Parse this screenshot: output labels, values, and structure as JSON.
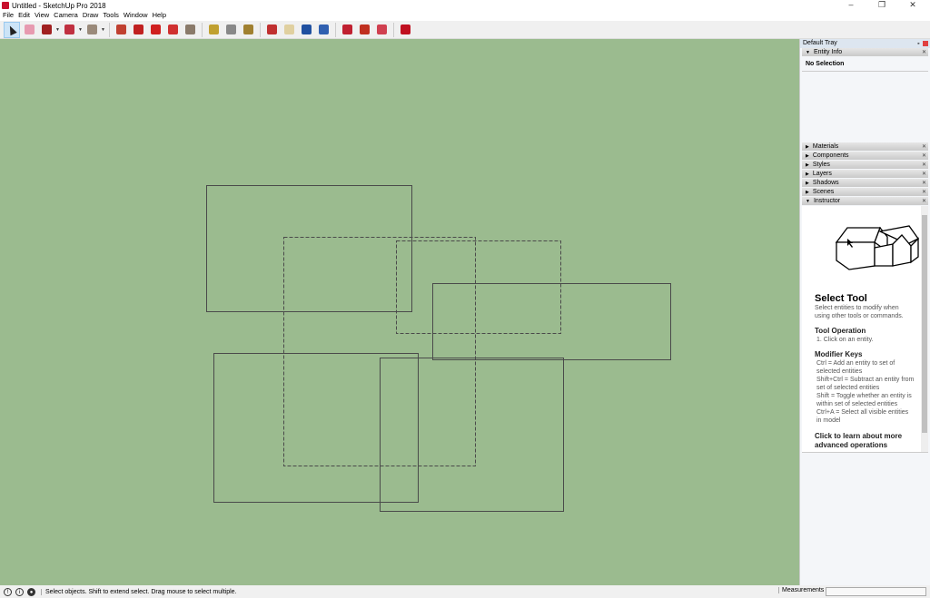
{
  "window": {
    "title": "Untitled - SketchUp Pro 2018",
    "controls": [
      "–",
      "❐",
      "✕"
    ]
  },
  "menu": [
    "File",
    "Edit",
    "View",
    "Camera",
    "Draw",
    "Tools",
    "Window",
    "Help"
  ],
  "toolbar": [
    {
      "icon": "select-icon",
      "color": "#222",
      "active": true
    },
    {
      "icon": "eraser-icon",
      "color": "#e79ab0"
    },
    {
      "icon": "pencil-icon",
      "color": "#a02020",
      "dropdown": true
    },
    {
      "icon": "arc-icon",
      "color": "#c03040",
      "dropdown": true
    },
    {
      "icon": "rectangle-icon",
      "color": "#9a8a7a",
      "dropdown": true
    },
    {
      "sep": true
    },
    {
      "icon": "push-pull-icon",
      "color": "#c04030"
    },
    {
      "icon": "offset-icon",
      "color": "#c02020"
    },
    {
      "icon": "move-icon",
      "color": "#d02020"
    },
    {
      "icon": "rotate-icon",
      "color": "#d03030"
    },
    {
      "icon": "scale-icon",
      "color": "#8a7a6a"
    },
    {
      "sep": true
    },
    {
      "icon": "tape-measure-icon",
      "color": "#c0a030"
    },
    {
      "icon": "text-icon",
      "color": "#888"
    },
    {
      "icon": "paint-bucket-icon",
      "color": "#a08030"
    },
    {
      "sep": true
    },
    {
      "icon": "orbit-icon",
      "color": "#c03030"
    },
    {
      "icon": "pan-icon",
      "color": "#e0d0a0"
    },
    {
      "icon": "zoom-icon",
      "color": "#2050a0"
    },
    {
      "icon": "zoom-extents-icon",
      "color": "#3060b0"
    },
    {
      "sep": true
    },
    {
      "icon": "3d-warehouse-icon",
      "color": "#c02030"
    },
    {
      "icon": "extension-warehouse-icon",
      "color": "#c03020"
    },
    {
      "icon": "send-to-layout-icon",
      "color": "#d04050"
    },
    {
      "sep": true
    },
    {
      "icon": "extension-manager-icon",
      "color": "#c01020"
    }
  ],
  "tray": {
    "title": "Default Tray",
    "entity_info": {
      "label": "Entity Info",
      "body": "No Selection"
    },
    "panels": [
      "Materials",
      "Components",
      "Styles",
      "Layers",
      "Shadows",
      "Scenes"
    ],
    "instructor": {
      "label": "Instructor",
      "title": "Select Tool",
      "desc": "Select entities to modify when using other tools or commands.",
      "op_title": "Tool Operation",
      "op_text": "1. Click on an entity.",
      "mod_title": "Modifier Keys",
      "mod_lines": [
        "Ctrl = Add an entity to set of selected entities",
        "Shift+Ctrl = Subtract an entity from set of selected entities",
        "Shift = Toggle whether an entity is within set of selected entities",
        "Ctrl+A = Select all visible entities in model"
      ],
      "more": "Click to learn about more advanced operations"
    }
  },
  "colors": {
    "canvas": "#9bbb8f",
    "edge": "#4a4a4a"
  },
  "status": {
    "text": "Select objects. Shift to extend select. Drag mouse to select multiple.",
    "measurements_label": "Measurements",
    "measurements_value": ""
  }
}
